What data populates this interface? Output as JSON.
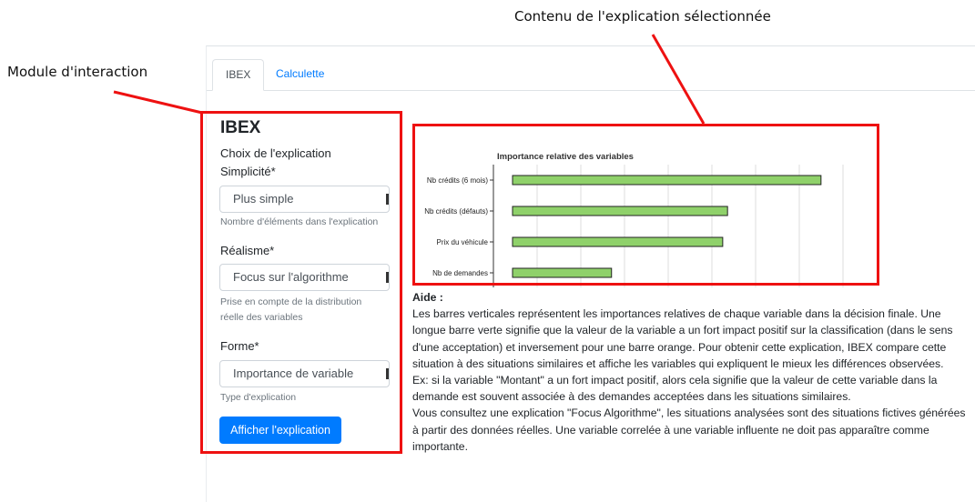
{
  "annotations": {
    "interaction_module": "Module d'interaction",
    "explanation_content": "Contenu de l'explication sélectionnée"
  },
  "tabs": [
    {
      "label": "IBEX",
      "active": true
    },
    {
      "label": "Calculette",
      "active": false
    }
  ],
  "left_panel": {
    "title": "IBEX",
    "section_label": "Choix de l'explication",
    "simplicity": {
      "label": "Simplicité*",
      "value": "Plus simple",
      "help": "Nombre d'éléments dans l'explication"
    },
    "realism": {
      "label": "Réalisme*",
      "value": "Focus sur l'algorithme",
      "help_line1": "Prise en compte de la distribution",
      "help_line2": "réelle des variables"
    },
    "form": {
      "label": "Forme*",
      "value": "Importance de variable",
      "help": "Type d'explication"
    },
    "show_button": "Afficher l'explication"
  },
  "chart_data": {
    "type": "bar",
    "orientation": "horizontal",
    "title": "Importance relative des variables",
    "categories": [
      "Nb crédits (6 mois)",
      "Nb crédits (défauts)",
      "Prix du véhicule",
      "Nb de demandes"
    ],
    "values": [
      0.96,
      0.67,
      0.655,
      0.31
    ],
    "xlim": [
      0,
      1
    ],
    "bar_color": "#8fd16a",
    "grid": true,
    "xlabel": "",
    "ylabel": ""
  },
  "help": {
    "title": "Aide :",
    "paragraph1": "Les barres verticales représentent les importances relatives de chaque variable dans la décision finale. Une longue barre verte signifie que la valeur de la variable a un fort impact positif sur la classification (dans le sens d'une acceptation) et inversement pour une barre orange. Pour obtenir cette explication, IBEX compare cette situation à des situations similaires et affiche les variables qui expliquent le mieux les différences observées.",
    "paragraph2": "Ex: si la variable \"Montant\" a un fort impact positif, alors cela signifie que la valeur de cette variable dans la demande est souvent associée à des demandes acceptées dans les situations similaires.",
    "paragraph3": "Vous consultez une explication \"Focus Algorithme\", les situations analysées sont des situations fictives générées à partir des données réelles. Une variable correlée à une variable influente ne doit pas apparaître comme importante."
  },
  "colors": {
    "accent": "#007bff",
    "annotation_red": "#ee1111"
  }
}
